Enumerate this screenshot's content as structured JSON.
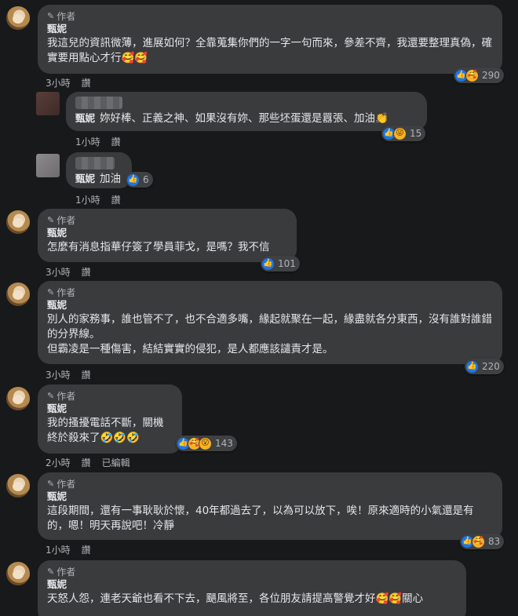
{
  "labels": {
    "author": "作者",
    "like": "讚",
    "edited": "已編輯",
    "pen_icon": "✎"
  },
  "comments": [
    {
      "name": "甄妮",
      "author_badge": true,
      "text": "我這兒的資訊微薄，進展如何？全靠蒐集你們的一字一句而來，參差不齊，我還要整理真偽，確實要用點心才行🥰🥰",
      "time": "3小時",
      "reactions": [
        "like",
        "care"
      ],
      "count": "290"
    },
    {
      "reply": true,
      "name": "甄妮",
      "text": "妳好棒、正義之神、如果沒有妳、那些坯蛋還是囂張、加油👏",
      "time": "1小時",
      "reactions": [
        "like",
        "haha"
      ],
      "count": "15"
    },
    {
      "reply": true,
      "name": "甄妮",
      "text": "加油",
      "time": "1小時",
      "reactions": [
        "like"
      ],
      "count": "6"
    },
    {
      "name": "甄妮",
      "author_badge": true,
      "text": "怎麼有消息指華仔簽了學員菲戈，是嗎？我不信",
      "time": "3小時",
      "reactions": [
        "like"
      ],
      "count": "101"
    },
    {
      "name": "甄妮",
      "author_badge": true,
      "text_lines": [
        "別人的家務事，誰也管不了，也不合適多嘴，緣起就聚在一起，緣盡就各分東西，沒有誰對誰錯的分界線。",
        "但霸凌是一種傷害，結結實實的侵犯，是人都應該譴責才是。"
      ],
      "time": "3小時",
      "reactions": [
        "like"
      ],
      "count": "220"
    },
    {
      "name": "甄妮",
      "author_badge": true,
      "text": "我的搔擾電話不斷，關機終於殺來了🤣🤣🤣",
      "time": "2小時",
      "edited": true,
      "reactions": [
        "like",
        "care",
        "wow"
      ],
      "count": "143"
    },
    {
      "name": "甄妮",
      "author_badge": true,
      "text": "這段期間，還有一事耿耿於懷，40年都過去了，以為可以放下，唉！原來適時的小氣還是有的，嗯！明天再說吧！冷靜",
      "time": "1小時",
      "reactions": [
        "like",
        "care"
      ],
      "count": "83"
    },
    {
      "name": "甄妮",
      "author_badge": true,
      "text": "天怒人怨，連老天爺也看不下去，颶風將至，各位朋友請提高警覺才好🥰🥰關心"
    }
  ]
}
